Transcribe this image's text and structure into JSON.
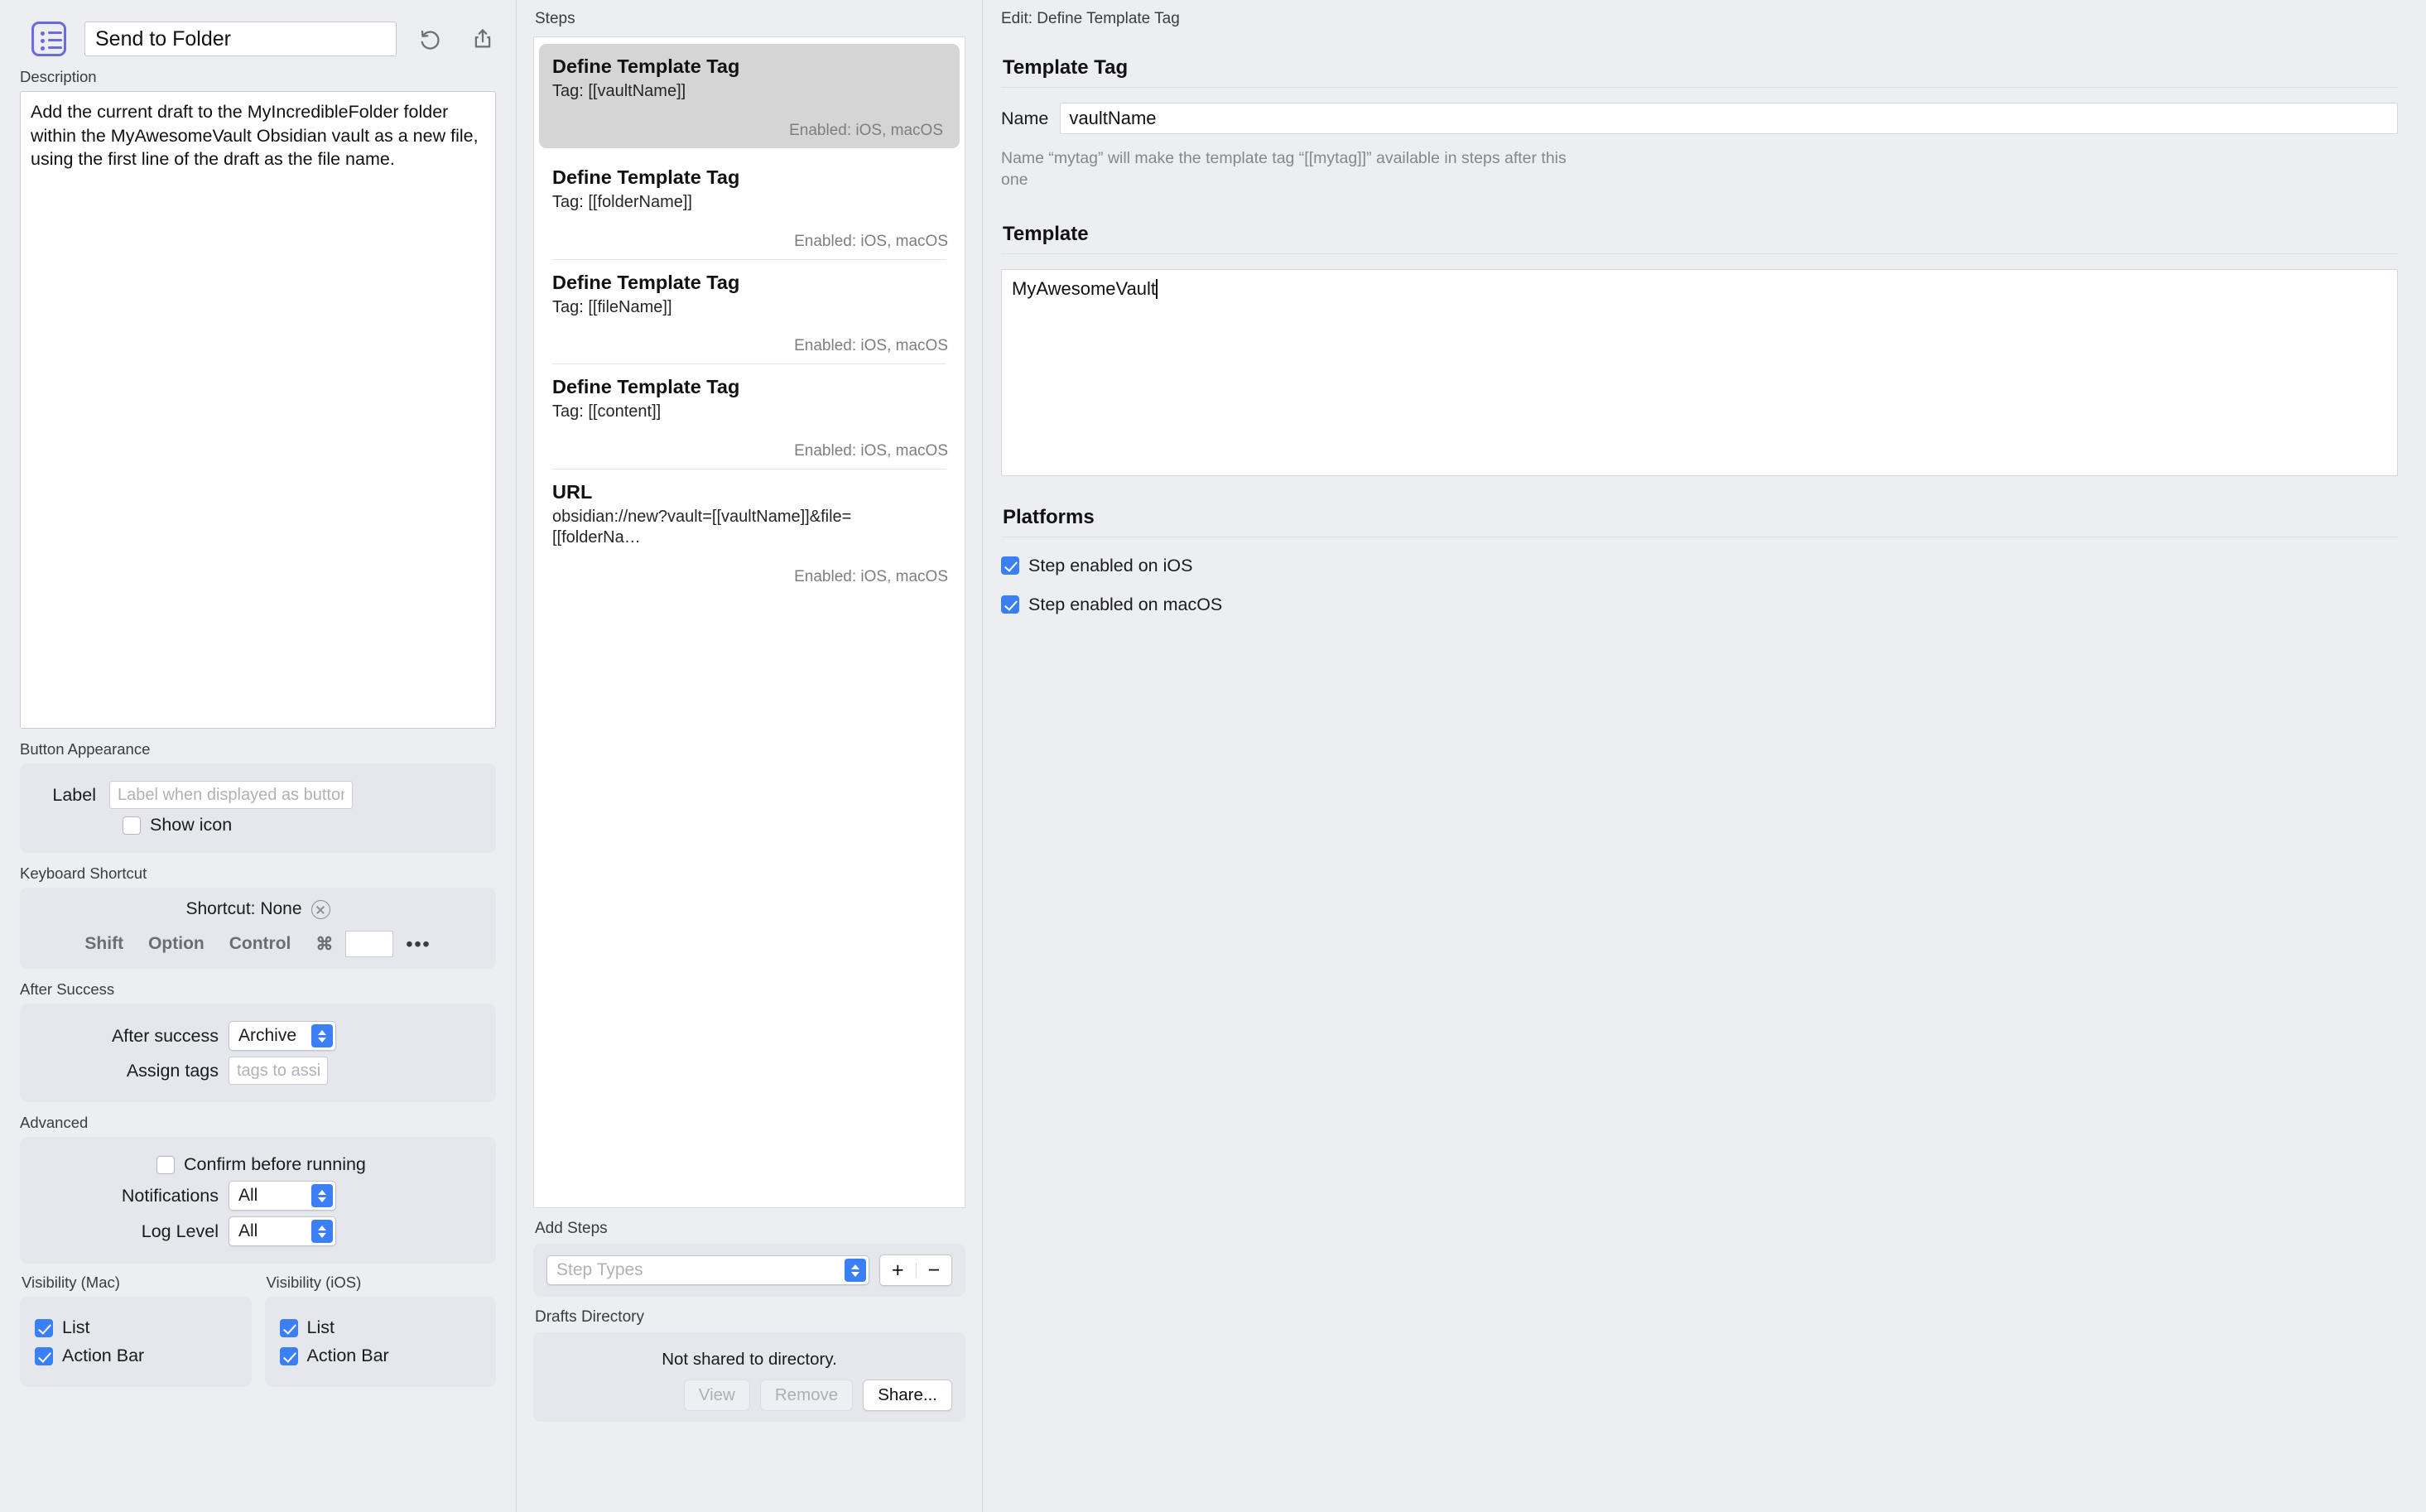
{
  "left": {
    "icon": "list-badge-icon",
    "title_value": "Send to Folder",
    "undo_icon": "undo-icon",
    "share_icon": "share-icon",
    "description_label": "Description",
    "description_value": "Add the current draft to the MyIncredibleFolder folder within the MyAwesomeVault Obsidian vault as a new file, using the first line of the draft as the file name.",
    "button_appearance": {
      "section_label": "Button Appearance",
      "label_label": "Label",
      "label_placeholder": "Label when displayed as button",
      "label_value": "",
      "show_icon_label": "Show icon",
      "show_icon_checked": false
    },
    "keyboard_shortcut": {
      "section_label": "Keyboard Shortcut",
      "shortcut_text": "Shortcut: None",
      "clear_icon": "clear-circle-icon",
      "modifiers": [
        "Shift",
        "Option",
        "Control",
        "⌘"
      ],
      "key_value": "",
      "more_label": "•••"
    },
    "after_success": {
      "section_label": "After Success",
      "after_success_label": "After success",
      "after_success_value": "Archive",
      "assign_tags_label": "Assign tags",
      "assign_tags_placeholder": "tags to assign",
      "assign_tags_value": ""
    },
    "advanced": {
      "section_label": "Advanced",
      "confirm_label": "Confirm before running",
      "confirm_checked": false,
      "notifications_label": "Notifications",
      "notifications_value": "All",
      "log_level_label": "Log Level",
      "log_level_value": "All"
    },
    "visibility_mac": {
      "section_label": "Visibility (Mac)",
      "items": [
        {
          "label": "List",
          "checked": true
        },
        {
          "label": "Action Bar",
          "checked": true
        }
      ]
    },
    "visibility_ios": {
      "section_label": "Visibility (iOS)",
      "items": [
        {
          "label": "List",
          "checked": true
        },
        {
          "label": "Action Bar",
          "checked": true
        }
      ]
    }
  },
  "steps_panel": {
    "header": "Steps",
    "steps": [
      {
        "title": "Define Template Tag",
        "sub": "Tag: [[vaultName]]",
        "enabled": "Enabled: iOS, macOS",
        "selected": true
      },
      {
        "title": "Define Template Tag",
        "sub": "Tag: [[folderName]]",
        "enabled": "Enabled: iOS, macOS",
        "selected": false
      },
      {
        "title": "Define Template Tag",
        "sub": "Tag: [[fileName]]",
        "enabled": "Enabled: iOS, macOS",
        "selected": false
      },
      {
        "title": "Define Template Tag",
        "sub": "Tag: [[content]]",
        "enabled": "Enabled: iOS, macOS",
        "selected": false
      },
      {
        "title": "URL",
        "sub": "obsidian://new?vault=[[vaultName]]&file=[[folderNa…",
        "enabled": "Enabled: iOS, macOS",
        "selected": false
      }
    ],
    "add_steps": {
      "section_label": "Add Steps",
      "step_types_placeholder": "Step Types",
      "step_types_value": "",
      "add_label": "+",
      "remove_label": "−"
    },
    "drafts_directory": {
      "section_label": "Drafts Directory",
      "status": "Not shared to directory.",
      "view_label": "View",
      "remove_label": "Remove",
      "share_label": "Share..."
    }
  },
  "editor": {
    "header": "Edit: Define Template Tag",
    "template_tag": {
      "section_label": "Template Tag",
      "name_label": "Name",
      "name_value": "vaultName",
      "hint": "Name “mytag” will make the template tag “[[mytag]]” available in steps after this one"
    },
    "template": {
      "section_label": "Template",
      "value": "MyAwesomeVault"
    },
    "platforms": {
      "section_label": "Platforms",
      "items": [
        {
          "label": "Step enabled on iOS",
          "checked": true
        },
        {
          "label": "Step enabled on macOS",
          "checked": true
        }
      ]
    }
  },
  "colors": {
    "accent": "#3b7ff6",
    "icon_purple": "#6b6ade",
    "window_bg": "#eceef2",
    "group_bg": "#e5e7ec",
    "selected_step_bg": "#d5d5d5"
  }
}
